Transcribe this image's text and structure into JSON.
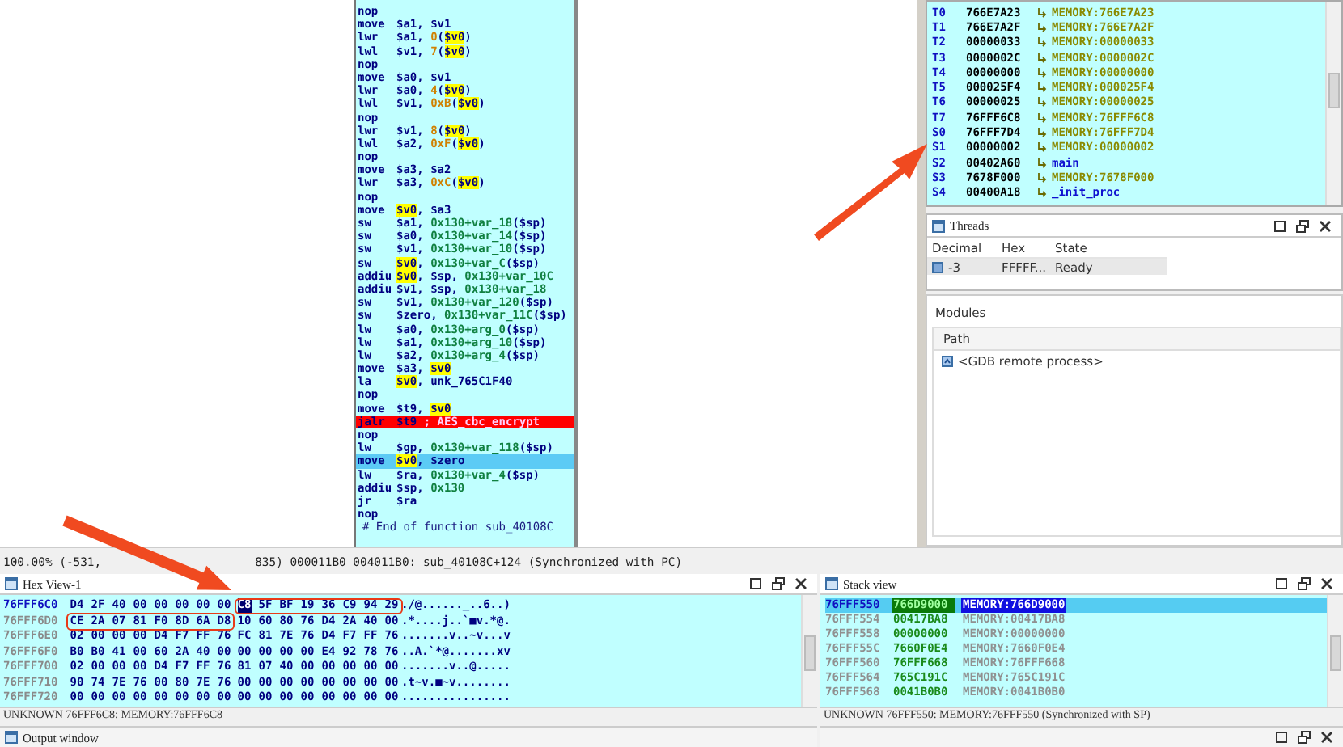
{
  "disassembly": {
    "lines": [
      {
        "kind": "insn",
        "breakpoint": false,
        "current": false,
        "mnemonic": "nop"
      },
      {
        "kind": "insn",
        "breakpoint": false,
        "current": false,
        "mnemonic": "move",
        "operands": [
          {
            "text": "$a1, $v1",
            "kind": "reg"
          }
        ]
      },
      {
        "kind": "insn",
        "breakpoint": false,
        "current": false,
        "mnemonic": "lwr",
        "operands": [
          {
            "text": "$a1, ",
            "kind": "reg"
          },
          {
            "text": "0",
            "kind": "num"
          },
          {
            "text": "(",
            "kind": "reg"
          },
          {
            "text": "$v0",
            "kind": "hl"
          },
          {
            "text": ")",
            "kind": "reg"
          }
        ]
      },
      {
        "kind": "insn",
        "breakpoint": false,
        "current": false,
        "mnemonic": "lwl",
        "operands": [
          {
            "text": "$v1, ",
            "kind": "reg"
          },
          {
            "text": "7",
            "kind": "num"
          },
          {
            "text": "(",
            "kind": "reg"
          },
          {
            "text": "$v0",
            "kind": "hl"
          },
          {
            "text": ")",
            "kind": "reg"
          }
        ]
      },
      {
        "kind": "insn",
        "breakpoint": false,
        "current": false,
        "mnemonic": "nop"
      },
      {
        "kind": "insn",
        "breakpoint": false,
        "current": false,
        "mnemonic": "move",
        "operands": [
          {
            "text": "$a0, $v1",
            "kind": "reg"
          }
        ]
      },
      {
        "kind": "insn",
        "breakpoint": false,
        "current": false,
        "mnemonic": "lwr",
        "operands": [
          {
            "text": "$a0, ",
            "kind": "reg"
          },
          {
            "text": "4",
            "kind": "num"
          },
          {
            "text": "(",
            "kind": "reg"
          },
          {
            "text": "$v0",
            "kind": "hl"
          },
          {
            "text": ")",
            "kind": "reg"
          }
        ]
      },
      {
        "kind": "insn",
        "breakpoint": false,
        "current": false,
        "mnemonic": "lwl",
        "operands": [
          {
            "text": "$v1, ",
            "kind": "reg"
          },
          {
            "text": "0xB",
            "kind": "num"
          },
          {
            "text": "(",
            "kind": "reg"
          },
          {
            "text": "$v0",
            "kind": "hl"
          },
          {
            "text": ")",
            "kind": "reg"
          }
        ]
      },
      {
        "kind": "insn",
        "breakpoint": false,
        "current": false,
        "mnemonic": "nop"
      },
      {
        "kind": "insn",
        "breakpoint": false,
        "current": false,
        "mnemonic": "lwr",
        "operands": [
          {
            "text": "$v1, ",
            "kind": "reg"
          },
          {
            "text": "8",
            "kind": "num"
          },
          {
            "text": "(",
            "kind": "reg"
          },
          {
            "text": "$v0",
            "kind": "hl"
          },
          {
            "text": ")",
            "kind": "reg"
          }
        ]
      },
      {
        "kind": "insn",
        "breakpoint": false,
        "current": false,
        "mnemonic": "lwl",
        "operands": [
          {
            "text": "$a2, ",
            "kind": "reg"
          },
          {
            "text": "0xF",
            "kind": "num"
          },
          {
            "text": "(",
            "kind": "reg"
          },
          {
            "text": "$v0",
            "kind": "hl"
          },
          {
            "text": ")",
            "kind": "reg"
          }
        ]
      },
      {
        "kind": "insn",
        "breakpoint": false,
        "current": false,
        "mnemonic": "nop"
      },
      {
        "kind": "insn",
        "breakpoint": false,
        "current": false,
        "mnemonic": "move",
        "operands": [
          {
            "text": "$a3, $a2",
            "kind": "reg"
          }
        ]
      },
      {
        "kind": "insn",
        "breakpoint": false,
        "current": false,
        "mnemonic": "lwr",
        "operands": [
          {
            "text": "$a3, ",
            "kind": "reg"
          },
          {
            "text": "0xC",
            "kind": "num"
          },
          {
            "text": "(",
            "kind": "reg"
          },
          {
            "text": "$v0",
            "kind": "hl"
          },
          {
            "text": ")",
            "kind": "reg"
          }
        ]
      },
      {
        "kind": "insn",
        "breakpoint": false,
        "current": false,
        "mnemonic": "nop"
      },
      {
        "kind": "insn",
        "breakpoint": false,
        "current": false,
        "mnemonic": "move",
        "operands": [
          {
            "text": "$v0",
            "kind": "hl"
          },
          {
            "text": ", $a3",
            "kind": "reg"
          }
        ]
      },
      {
        "kind": "insn",
        "breakpoint": false,
        "current": false,
        "mnemonic": "sw",
        "operands": [
          {
            "text": "$a1, ",
            "kind": "reg"
          },
          {
            "text": "0x130+var_18",
            "kind": "sym"
          },
          {
            "text": "($sp)",
            "kind": "reg"
          }
        ]
      },
      {
        "kind": "insn",
        "breakpoint": false,
        "current": false,
        "mnemonic": "sw",
        "operands": [
          {
            "text": "$a0, ",
            "kind": "reg"
          },
          {
            "text": "0x130+var_14",
            "kind": "sym"
          },
          {
            "text": "($sp)",
            "kind": "reg"
          }
        ]
      },
      {
        "kind": "insn",
        "breakpoint": false,
        "current": false,
        "mnemonic": "sw",
        "operands": [
          {
            "text": "$v1, ",
            "kind": "reg"
          },
          {
            "text": "0x130+var_10",
            "kind": "sym"
          },
          {
            "text": "($sp)",
            "kind": "reg"
          }
        ]
      },
      {
        "kind": "insn",
        "breakpoint": false,
        "current": false,
        "mnemonic": "sw",
        "operands": [
          {
            "text": "$v0",
            "kind": "hl"
          },
          {
            "text": ", ",
            "kind": "reg"
          },
          {
            "text": "0x130+var_C",
            "kind": "sym"
          },
          {
            "text": "($sp)",
            "kind": "reg"
          }
        ]
      },
      {
        "kind": "insn",
        "breakpoint": false,
        "current": false,
        "mnemonic": "addiu",
        "operands": [
          {
            "text": "$v0",
            "kind": "hl"
          },
          {
            "text": ", $sp, ",
            "kind": "reg"
          },
          {
            "text": "0x130+var_10C",
            "kind": "sym"
          }
        ]
      },
      {
        "kind": "insn",
        "breakpoint": false,
        "current": false,
        "mnemonic": "addiu",
        "operands": [
          {
            "text": "$v1, $sp, ",
            "kind": "reg"
          },
          {
            "text": "0x130+var_18",
            "kind": "sym"
          }
        ]
      },
      {
        "kind": "insn",
        "breakpoint": false,
        "current": false,
        "mnemonic": "sw",
        "operands": [
          {
            "text": "$v1, ",
            "kind": "reg"
          },
          {
            "text": "0x130+var_120",
            "kind": "sym"
          },
          {
            "text": "($sp)",
            "kind": "reg"
          }
        ]
      },
      {
        "kind": "insn",
        "breakpoint": false,
        "current": false,
        "mnemonic": "sw",
        "operands": [
          {
            "text": "$zero, ",
            "kind": "reg"
          },
          {
            "text": "0x130+var_11C",
            "kind": "sym"
          },
          {
            "text": "($sp)",
            "kind": "reg"
          }
        ]
      },
      {
        "kind": "insn",
        "breakpoint": false,
        "current": false,
        "mnemonic": "lw",
        "operands": [
          {
            "text": "$a0, ",
            "kind": "reg"
          },
          {
            "text": "0x130+arg_0",
            "kind": "sym"
          },
          {
            "text": "($sp)",
            "kind": "reg"
          }
        ]
      },
      {
        "kind": "insn",
        "breakpoint": false,
        "current": false,
        "mnemonic": "lw",
        "operands": [
          {
            "text": "$a1, ",
            "kind": "reg"
          },
          {
            "text": "0x130+arg_10",
            "kind": "sym"
          },
          {
            "text": "($sp)",
            "kind": "reg"
          }
        ]
      },
      {
        "kind": "insn",
        "breakpoint": false,
        "current": false,
        "mnemonic": "lw",
        "operands": [
          {
            "text": "$a2, ",
            "kind": "reg"
          },
          {
            "text": "0x130+arg_4",
            "kind": "sym"
          },
          {
            "text": "($sp)",
            "kind": "reg"
          }
        ]
      },
      {
        "kind": "insn",
        "breakpoint": false,
        "current": false,
        "mnemonic": "move",
        "operands": [
          {
            "text": "$a3, ",
            "kind": "reg"
          },
          {
            "text": "$v0",
            "kind": "hl"
          }
        ]
      },
      {
        "kind": "insn",
        "breakpoint": false,
        "current": false,
        "mnemonic": "la",
        "operands": [
          {
            "text": "$v0",
            "kind": "hl"
          },
          {
            "text": ", unk_765C1F40",
            "kind": "reg"
          }
        ]
      },
      {
        "kind": "insn",
        "breakpoint": false,
        "current": false,
        "mnemonic": "nop"
      },
      {
        "kind": "insn",
        "breakpoint": false,
        "current": false,
        "mnemonic": "move",
        "operands": [
          {
            "text": "$t9, ",
            "kind": "reg"
          },
          {
            "text": "$v0",
            "kind": "hl"
          }
        ]
      },
      {
        "kind": "insn",
        "breakpoint": true,
        "current": false,
        "mnemonic": "jalr",
        "operands": [
          {
            "text": "$t9",
            "kind": "reg"
          },
          {
            "text": " ; AES_cbc_encrypt",
            "kind": "comment"
          }
        ]
      },
      {
        "kind": "insn",
        "breakpoint": false,
        "current": false,
        "mnemonic": "nop"
      },
      {
        "kind": "insn",
        "breakpoint": false,
        "current": false,
        "mnemonic": "lw",
        "operands": [
          {
            "text": "$gp, ",
            "kind": "reg"
          },
          {
            "text": "0x130+var_118",
            "kind": "sym"
          },
          {
            "text": "($sp)",
            "kind": "reg"
          }
        ]
      },
      {
        "kind": "insn",
        "breakpoint": false,
        "current": true,
        "mnemonic": "move",
        "operands": [
          {
            "text": "$v0",
            "kind": "hl"
          },
          {
            "text": ", $zero",
            "kind": "reg"
          }
        ]
      },
      {
        "kind": "insn",
        "breakpoint": false,
        "current": false,
        "mnemonic": "lw",
        "operands": [
          {
            "text": "$ra, ",
            "kind": "reg"
          },
          {
            "text": "0x130+var_4",
            "kind": "sym"
          },
          {
            "text": "($sp)",
            "kind": "reg"
          }
        ]
      },
      {
        "kind": "insn",
        "breakpoint": false,
        "current": false,
        "mnemonic": "addiu",
        "operands": [
          {
            "text": "$sp, ",
            "kind": "reg"
          },
          {
            "text": "0x130",
            "kind": "sym"
          }
        ]
      },
      {
        "kind": "insn",
        "breakpoint": false,
        "current": false,
        "mnemonic": "jr",
        "operands": [
          {
            "text": "$ra",
            "kind": "reg"
          }
        ]
      },
      {
        "kind": "insn",
        "breakpoint": false,
        "current": false,
        "mnemonic": "nop"
      },
      {
        "kind": "comment",
        "breakpoint": false,
        "current": false,
        "text": "# End of function sub_40108C"
      }
    ]
  },
  "registers": [
    {
      "name": "T0",
      "value": "766E7A23",
      "kind": "memory",
      "target": "MEMORY:766E7A23"
    },
    {
      "name": "T1",
      "value": "766E7A2F",
      "kind": "memory",
      "target": "MEMORY:766E7A2F"
    },
    {
      "name": "T2",
      "value": "00000033",
      "kind": "memory",
      "target": "MEMORY:00000033"
    },
    {
      "name": "T3",
      "value": "0000002C",
      "kind": "memory",
      "target": "MEMORY:0000002C"
    },
    {
      "name": "T4",
      "value": "00000000",
      "kind": "memory",
      "target": "MEMORY:00000000"
    },
    {
      "name": "T5",
      "value": "000025F4",
      "kind": "memory",
      "target": "MEMORY:000025F4"
    },
    {
      "name": "T6",
      "value": "00000025",
      "kind": "memory",
      "target": "MEMORY:00000025"
    },
    {
      "name": "T7",
      "value": "76FFF6C8",
      "kind": "memory",
      "target": "MEMORY:76FFF6C8"
    },
    {
      "name": "S0",
      "value": "76FFF7D4",
      "kind": "memory",
      "target": "MEMORY:76FFF7D4"
    },
    {
      "name": "S1",
      "value": "00000002",
      "kind": "memory",
      "target": "MEMORY:00000002"
    },
    {
      "name": "S2",
      "value": "00402A60",
      "kind": "code",
      "target": "main"
    },
    {
      "name": "S3",
      "value": "7678F000",
      "kind": "memory",
      "target": "MEMORY:7678F000"
    },
    {
      "name": "S4",
      "value": "00400A18",
      "kind": "code",
      "target": "_init_proc"
    }
  ],
  "threads": {
    "title": "Threads",
    "columns": [
      "Decimal",
      "Hex",
      "State"
    ],
    "rows": [
      {
        "selected": true,
        "cells": [
          "-3",
          "FFFFF...",
          "Ready"
        ]
      }
    ]
  },
  "modules": {
    "title": "Modules",
    "columns": [
      "Path"
    ],
    "rows": [
      {
        "selected": false,
        "path": "<GDB remote process>"
      }
    ]
  },
  "status_line": {
    "left": "100.00% (-531,",
    "right": "835) 000011B0 004011B0: sub_40108C+124 (Synchronized with PC)"
  },
  "hex_view": {
    "title": "Hex View-1",
    "rows": [
      {
        "address": "76FFF6C0",
        "selected": true,
        "ascii": "./@......_..6..)",
        "bytes": [
          {
            "v": "D4",
            "selected": false
          },
          {
            "v": "2F",
            "selected": false
          },
          {
            "v": "40",
            "selected": false
          },
          {
            "v": "00",
            "selected": false
          },
          {
            "v": "00",
            "selected": false
          },
          {
            "v": "00",
            "selected": false
          },
          {
            "v": "00",
            "selected": false
          },
          {
            "v": "00",
            "selected": false
          },
          {
            "v": "C8",
            "selected": true
          },
          {
            "v": "5F",
            "selected": false
          },
          {
            "v": "BF",
            "selected": false
          },
          {
            "v": "19",
            "selected": false
          },
          {
            "v": "36",
            "selected": false
          },
          {
            "v": "C9",
            "selected": false
          },
          {
            "v": "94",
            "selected": false
          },
          {
            "v": "29",
            "selected": false
          }
        ]
      },
      {
        "address": "76FFF6D0",
        "selected": false,
        "ascii": ".*....j..`■v.*@.",
        "bytes": [
          {
            "v": "CE",
            "selected": false
          },
          {
            "v": "2A",
            "selected": false
          },
          {
            "v": "07",
            "selected": false
          },
          {
            "v": "81",
            "selected": false
          },
          {
            "v": "F0",
            "selected": false
          },
          {
            "v": "8D",
            "selected": false
          },
          {
            "v": "6A",
            "selected": false
          },
          {
            "v": "D8",
            "selected": false
          },
          {
            "v": "10",
            "selected": false
          },
          {
            "v": "60",
            "selected": false
          },
          {
            "v": "80",
            "selected": false
          },
          {
            "v": "76",
            "selected": false
          },
          {
            "v": "D4",
            "selected": false
          },
          {
            "v": "2A",
            "selected": false
          },
          {
            "v": "40",
            "selected": false
          },
          {
            "v": "00",
            "selected": false
          }
        ]
      },
      {
        "address": "76FFF6E0",
        "selected": false,
        "ascii": ".......v..~v...v",
        "bytes": [
          {
            "v": "02",
            "selected": false
          },
          {
            "v": "00",
            "selected": false
          },
          {
            "v": "00",
            "selected": false
          },
          {
            "v": "00",
            "selected": false
          },
          {
            "v": "D4",
            "selected": false
          },
          {
            "v": "F7",
            "selected": false
          },
          {
            "v": "FF",
            "selected": false
          },
          {
            "v": "76",
            "selected": false
          },
          {
            "v": "FC",
            "selected": false
          },
          {
            "v": "81",
            "selected": false
          },
          {
            "v": "7E",
            "selected": false
          },
          {
            "v": "76",
            "selected": false
          },
          {
            "v": "D4",
            "selected": false
          },
          {
            "v": "F7",
            "selected": false
          },
          {
            "v": "FF",
            "selected": false
          },
          {
            "v": "76",
            "selected": false
          }
        ]
      },
      {
        "address": "76FFF6F0",
        "selected": false,
        "ascii": "..A.`*@.......xv",
        "bytes": [
          {
            "v": "B0",
            "selected": false
          },
          {
            "v": "B0",
            "selected": false
          },
          {
            "v": "41",
            "selected": false
          },
          {
            "v": "00",
            "selected": false
          },
          {
            "v": "60",
            "selected": false
          },
          {
            "v": "2A",
            "selected": false
          },
          {
            "v": "40",
            "selected": false
          },
          {
            "v": "00",
            "selected": false
          },
          {
            "v": "00",
            "selected": false
          },
          {
            "v": "00",
            "selected": false
          },
          {
            "v": "00",
            "selected": false
          },
          {
            "v": "00",
            "selected": false
          },
          {
            "v": "E4",
            "selected": false
          },
          {
            "v": "92",
            "selected": false
          },
          {
            "v": "78",
            "selected": false
          },
          {
            "v": "76",
            "selected": false
          }
        ]
      },
      {
        "address": "76FFF700",
        "selected": false,
        "ascii": ".......v..@.....",
        "bytes": [
          {
            "v": "02",
            "selected": false
          },
          {
            "v": "00",
            "selected": false
          },
          {
            "v": "00",
            "selected": false
          },
          {
            "v": "00",
            "selected": false
          },
          {
            "v": "D4",
            "selected": false
          },
          {
            "v": "F7",
            "selected": false
          },
          {
            "v": "FF",
            "selected": false
          },
          {
            "v": "76",
            "selected": false
          },
          {
            "v": "81",
            "selected": false
          },
          {
            "v": "07",
            "selected": false
          },
          {
            "v": "40",
            "selected": false
          },
          {
            "v": "00",
            "selected": false
          },
          {
            "v": "00",
            "selected": false
          },
          {
            "v": "00",
            "selected": false
          },
          {
            "v": "00",
            "selected": false
          },
          {
            "v": "00",
            "selected": false
          }
        ]
      },
      {
        "address": "76FFF710",
        "selected": false,
        "ascii": ".t~v.■~v........",
        "bytes": [
          {
            "v": "90",
            "selected": false
          },
          {
            "v": "74",
            "selected": false
          },
          {
            "v": "7E",
            "selected": false
          },
          {
            "v": "76",
            "selected": false
          },
          {
            "v": "00",
            "selected": false
          },
          {
            "v": "80",
            "selected": false
          },
          {
            "v": "7E",
            "selected": false
          },
          {
            "v": "76",
            "selected": false
          },
          {
            "v": "00",
            "selected": false
          },
          {
            "v": "00",
            "selected": false
          },
          {
            "v": "00",
            "selected": false
          },
          {
            "v": "00",
            "selected": false
          },
          {
            "v": "00",
            "selected": false
          },
          {
            "v": "00",
            "selected": false
          },
          {
            "v": "00",
            "selected": false
          },
          {
            "v": "00",
            "selected": false
          }
        ]
      },
      {
        "address": "76FFF720",
        "selected": false,
        "ascii": "................",
        "bytes": [
          {
            "v": "00",
            "selected": false
          },
          {
            "v": "00",
            "selected": false
          },
          {
            "v": "00",
            "selected": false
          },
          {
            "v": "00",
            "selected": false
          },
          {
            "v": "00",
            "selected": false
          },
          {
            "v": "00",
            "selected": false
          },
          {
            "v": "00",
            "selected": false
          },
          {
            "v": "00",
            "selected": false
          },
          {
            "v": "00",
            "selected": false
          },
          {
            "v": "00",
            "selected": false
          },
          {
            "v": "00",
            "selected": false
          },
          {
            "v": "00",
            "selected": false
          },
          {
            "v": "00",
            "selected": false
          },
          {
            "v": "00",
            "selected": false
          },
          {
            "v": "00",
            "selected": false
          },
          {
            "v": "00",
            "selected": false
          }
        ]
      }
    ],
    "status": "UNKNOWN 76FFF6C8: MEMORY:76FFF6C8"
  },
  "stack_view": {
    "title": "Stack view",
    "rows": [
      {
        "address": "76FFF550",
        "value": "766D9000",
        "target": "MEMORY:766D9000",
        "selected": true
      },
      {
        "address": "76FFF554",
        "value": "00417BA8",
        "target": "MEMORY:00417BA8",
        "selected": false
      },
      {
        "address": "76FFF558",
        "value": "00000000",
        "target": "MEMORY:00000000",
        "selected": false
      },
      {
        "address": "76FFF55C",
        "value": "7660F0E4",
        "target": "MEMORY:7660F0E4",
        "selected": false
      },
      {
        "address": "76FFF560",
        "value": "76FFF668",
        "target": "MEMORY:76FFF668",
        "selected": false
      },
      {
        "address": "76FFF564",
        "value": "765C191C",
        "target": "MEMORY:765C191C",
        "selected": false
      },
      {
        "address": "76FFF568",
        "value": "0041B0B0",
        "target": "MEMORY:0041B0B0",
        "selected": false
      }
    ],
    "status": "UNKNOWN 76FFF550: MEMORY:76FFF550 (Synchronized with SP)"
  },
  "output_window": {
    "title": "Output window"
  }
}
